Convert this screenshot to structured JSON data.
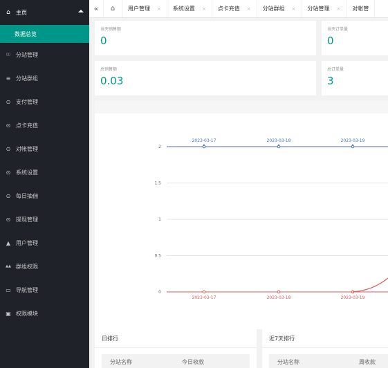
{
  "sidebar": {
    "home_label": "主页",
    "sub_active": "数据总览",
    "items": [
      {
        "label": "分站管理",
        "icon": "columns-icon"
      },
      {
        "label": "分站群组",
        "icon": "sliders-icon"
      },
      {
        "label": "支付管理",
        "icon": "circle-check-icon"
      },
      {
        "label": "点卡充值",
        "icon": "circle-check-icon"
      },
      {
        "label": "对帐管理",
        "icon": "circle-check-icon"
      },
      {
        "label": "系统设置",
        "icon": "circle-check-icon"
      },
      {
        "label": "每日抽佣",
        "icon": "circle-check-icon"
      },
      {
        "label": "提现管理",
        "icon": "circle-check-icon"
      },
      {
        "label": "用户管理",
        "icon": "user-icon"
      },
      {
        "label": "群组权限",
        "icon": "users-icon"
      },
      {
        "label": "导航管理",
        "icon": "nav-icon"
      },
      {
        "label": "权限模块",
        "icon": "module-icon"
      }
    ]
  },
  "topbar": {
    "tabs": [
      "用户管理",
      "系统设置",
      "点卡充值",
      "分站群组",
      "分站管理",
      "对帐管"
    ]
  },
  "stats": [
    {
      "label": "当天销售额",
      "value": "0"
    },
    {
      "label": "当天订单量",
      "value": "0"
    },
    {
      "label": "总销售额",
      "value": "0.03"
    },
    {
      "label": "总订单量",
      "value": "3"
    }
  ],
  "chart_data": {
    "type": "line",
    "x": [
      "2023-03-17",
      "2023-03-18",
      "2023-03-19"
    ],
    "series": [
      {
        "values": [
          2,
          2,
          2
        ],
        "color": "#4a6fc7",
        "axis": "top"
      },
      {
        "values": [
          0,
          0,
          0
        ],
        "color": "#e0585b",
        "axis": "bottom"
      }
    ],
    "yticks": [
      "2",
      "1.5",
      "1",
      "0.5",
      "0"
    ],
    "ylim": [
      0,
      2
    ]
  },
  "rank_today": {
    "title": "日排行",
    "col1": "分站名称",
    "col2": "今日收款"
  },
  "rank_week": {
    "title": "近7天排行",
    "col1": "分站名称",
    "col2": "周收款"
  }
}
